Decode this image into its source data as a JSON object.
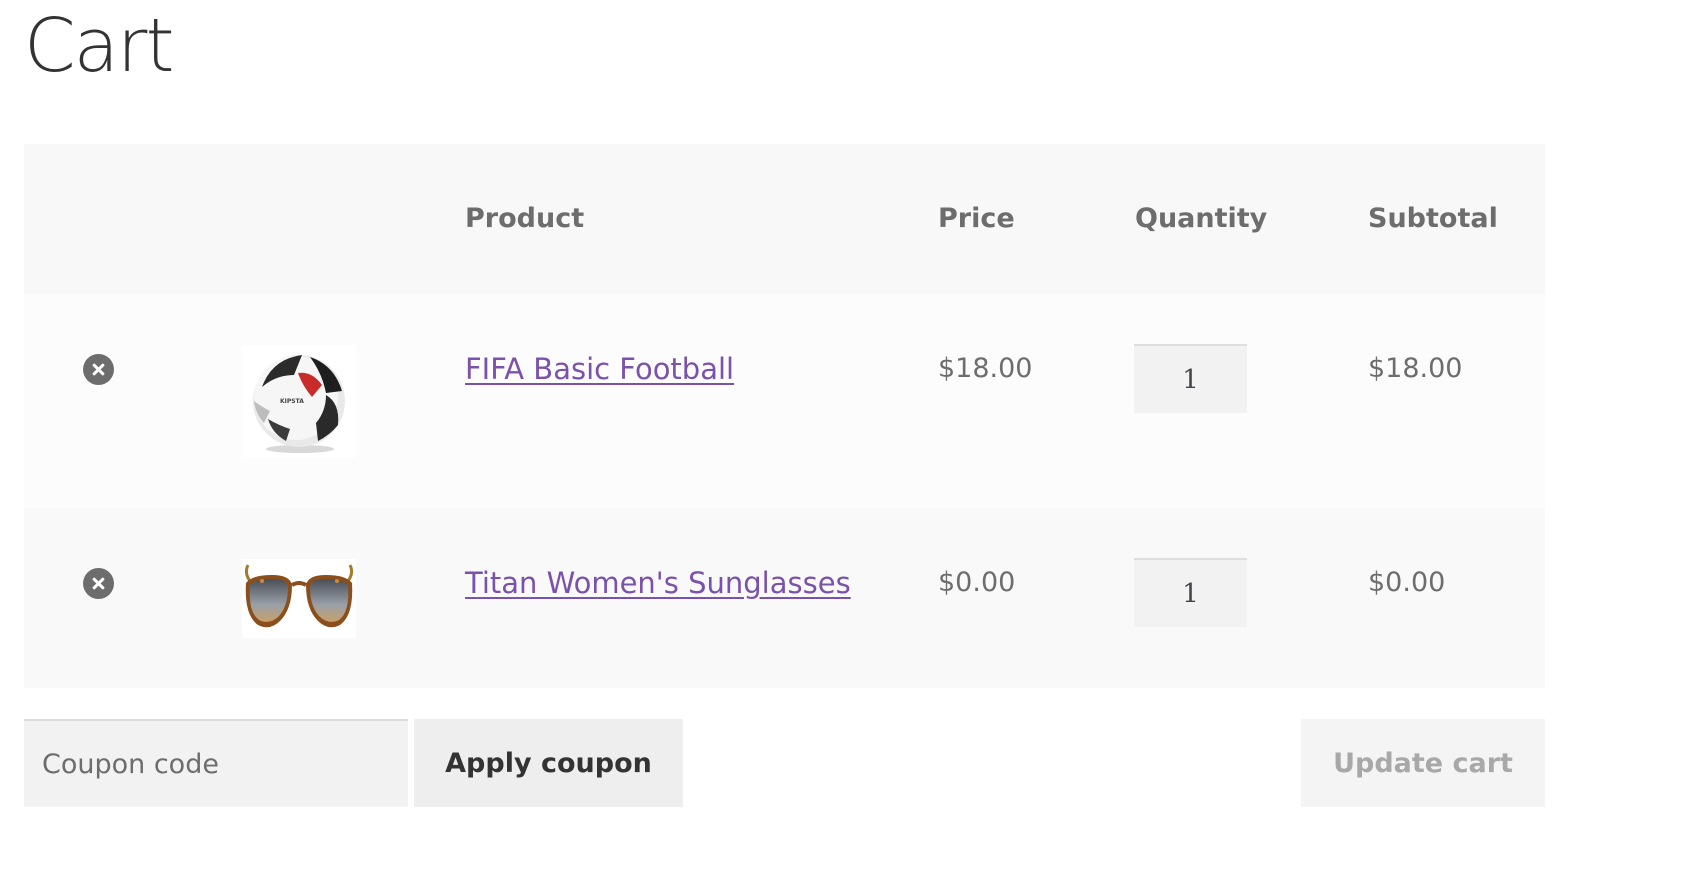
{
  "page": {
    "title": "Cart"
  },
  "table": {
    "headers": {
      "product": "Product",
      "price": "Price",
      "quantity": "Quantity",
      "subtotal": "Subtotal"
    },
    "rows": [
      {
        "name": "FIFA Basic Football",
        "price": "$18.00",
        "quantity": "1",
        "subtotal": "$18.00",
        "thumbnail_icon": "football-image",
        "remove_icon": "remove-icon"
      },
      {
        "name": "Titan Women's Sunglasses",
        "price": "$0.00",
        "quantity": "1",
        "subtotal": "$0.00",
        "thumbnail_icon": "sunglasses-image",
        "remove_icon": "remove-icon"
      }
    ]
  },
  "actions": {
    "coupon_placeholder": "Coupon code",
    "apply_coupon_label": "Apply coupon",
    "update_cart_label": "Update cart"
  },
  "colors": {
    "link": "#7b52ab",
    "text": "#6d6d6d",
    "header_bg": "#f8f8f8",
    "row_bg": "#fcfcfc",
    "button_bg": "#eeeeee"
  }
}
